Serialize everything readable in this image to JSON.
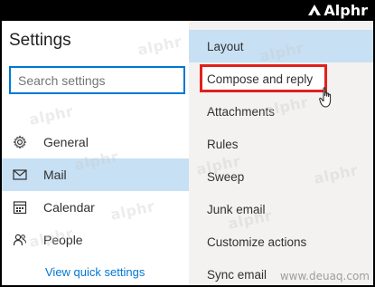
{
  "brand": {
    "name": "Alphr"
  },
  "settings": {
    "title": "Settings",
    "search_placeholder": "Search settings",
    "nav": [
      {
        "label": "General",
        "icon": "gear-icon",
        "active": false
      },
      {
        "label": "Mail",
        "icon": "mail-icon",
        "active": true
      },
      {
        "label": "Calendar",
        "icon": "calendar-icon",
        "active": false
      },
      {
        "label": "People",
        "icon": "people-icon",
        "active": false
      }
    ],
    "quick_settings_link": "View quick settings"
  },
  "mail_menu": {
    "items": [
      {
        "label": "Layout",
        "active": true
      },
      {
        "label": "Compose and reply",
        "highlighted": true
      },
      {
        "label": "Attachments"
      },
      {
        "label": "Rules"
      },
      {
        "label": "Sweep"
      },
      {
        "label": "Junk email"
      },
      {
        "label": "Customize actions"
      },
      {
        "label": "Sync email"
      }
    ]
  },
  "watermark": {
    "text": "alphr",
    "site": "www.deuaq.com"
  },
  "colors": {
    "accent": "#0078d4",
    "selected_bg": "#c7e0f4",
    "highlight_box": "#e0211b",
    "right_panel_bg": "#f3f2f1"
  }
}
